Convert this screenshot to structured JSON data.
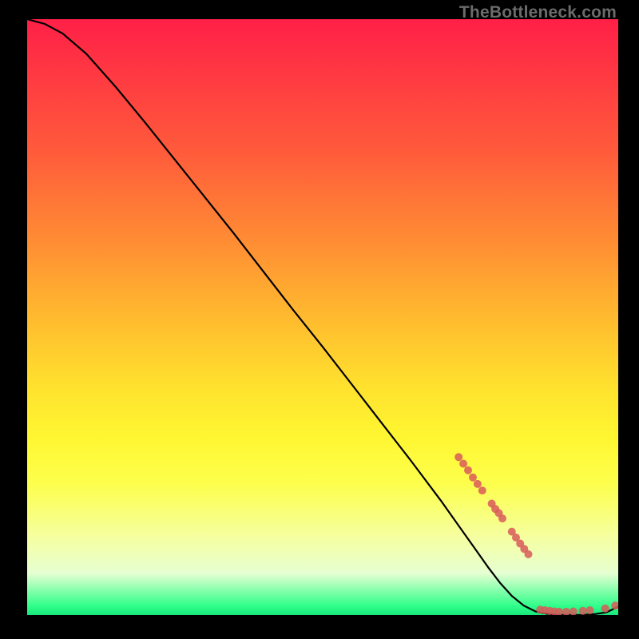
{
  "watermark": "TheBottleneck.com",
  "chart_data": {
    "type": "line",
    "title": "",
    "xlabel": "",
    "ylabel": "",
    "xlim": [
      0,
      100
    ],
    "ylim": [
      0,
      100
    ],
    "series": [
      {
        "name": "curve",
        "x": [
          0,
          3,
          6,
          10,
          15,
          20,
          25,
          30,
          35,
          40,
          45,
          50,
          55,
          60,
          65,
          70,
          73,
          76,
          78,
          80,
          82,
          84,
          86,
          88,
          90,
          92,
          94,
          96,
          98,
          100
        ],
        "y": [
          100,
          99.2,
          97.6,
          94.2,
          88.6,
          82.6,
          76.4,
          70.2,
          64.0,
          57.6,
          51.2,
          45.0,
          38.6,
          32.2,
          25.8,
          19.2,
          15.0,
          10.8,
          8.0,
          5.4,
          3.2,
          1.6,
          0.6,
          0.2,
          0.05,
          0.03,
          0.04,
          0.15,
          0.45,
          1.4
        ]
      }
    ],
    "marker_clusters": [
      {
        "name": "cluster-a",
        "points": [
          {
            "x": 73.0,
            "y": 26.5
          },
          {
            "x": 73.8,
            "y": 25.4
          },
          {
            "x": 74.6,
            "y": 24.3
          },
          {
            "x": 75.4,
            "y": 23.1
          },
          {
            "x": 76.2,
            "y": 22.0
          },
          {
            "x": 77.0,
            "y": 20.9
          },
          {
            "x": 78.6,
            "y": 18.7
          },
          {
            "x": 79.2,
            "y": 17.8
          },
          {
            "x": 79.8,
            "y": 17.1
          },
          {
            "x": 80.4,
            "y": 16.2
          }
        ]
      },
      {
        "name": "cluster-b",
        "points": [
          {
            "x": 82.0,
            "y": 14.0
          },
          {
            "x": 82.7,
            "y": 13.0
          },
          {
            "x": 83.4,
            "y": 12.0
          },
          {
            "x": 84.1,
            "y": 11.1
          },
          {
            "x": 84.8,
            "y": 10.2
          }
        ]
      },
      {
        "name": "cluster-c",
        "points": [
          {
            "x": 86.8,
            "y": 0.9
          },
          {
            "x": 87.6,
            "y": 0.8
          },
          {
            "x": 88.4,
            "y": 0.7
          },
          {
            "x": 89.2,
            "y": 0.6
          },
          {
            "x": 90.0,
            "y": 0.55
          },
          {
            "x": 91.2,
            "y": 0.55
          },
          {
            "x": 92.4,
            "y": 0.6
          },
          {
            "x": 94.0,
            "y": 0.7
          },
          {
            "x": 95.2,
            "y": 0.8
          },
          {
            "x": 97.8,
            "y": 1.1
          },
          {
            "x": 99.5,
            "y": 1.6
          }
        ]
      }
    ]
  }
}
